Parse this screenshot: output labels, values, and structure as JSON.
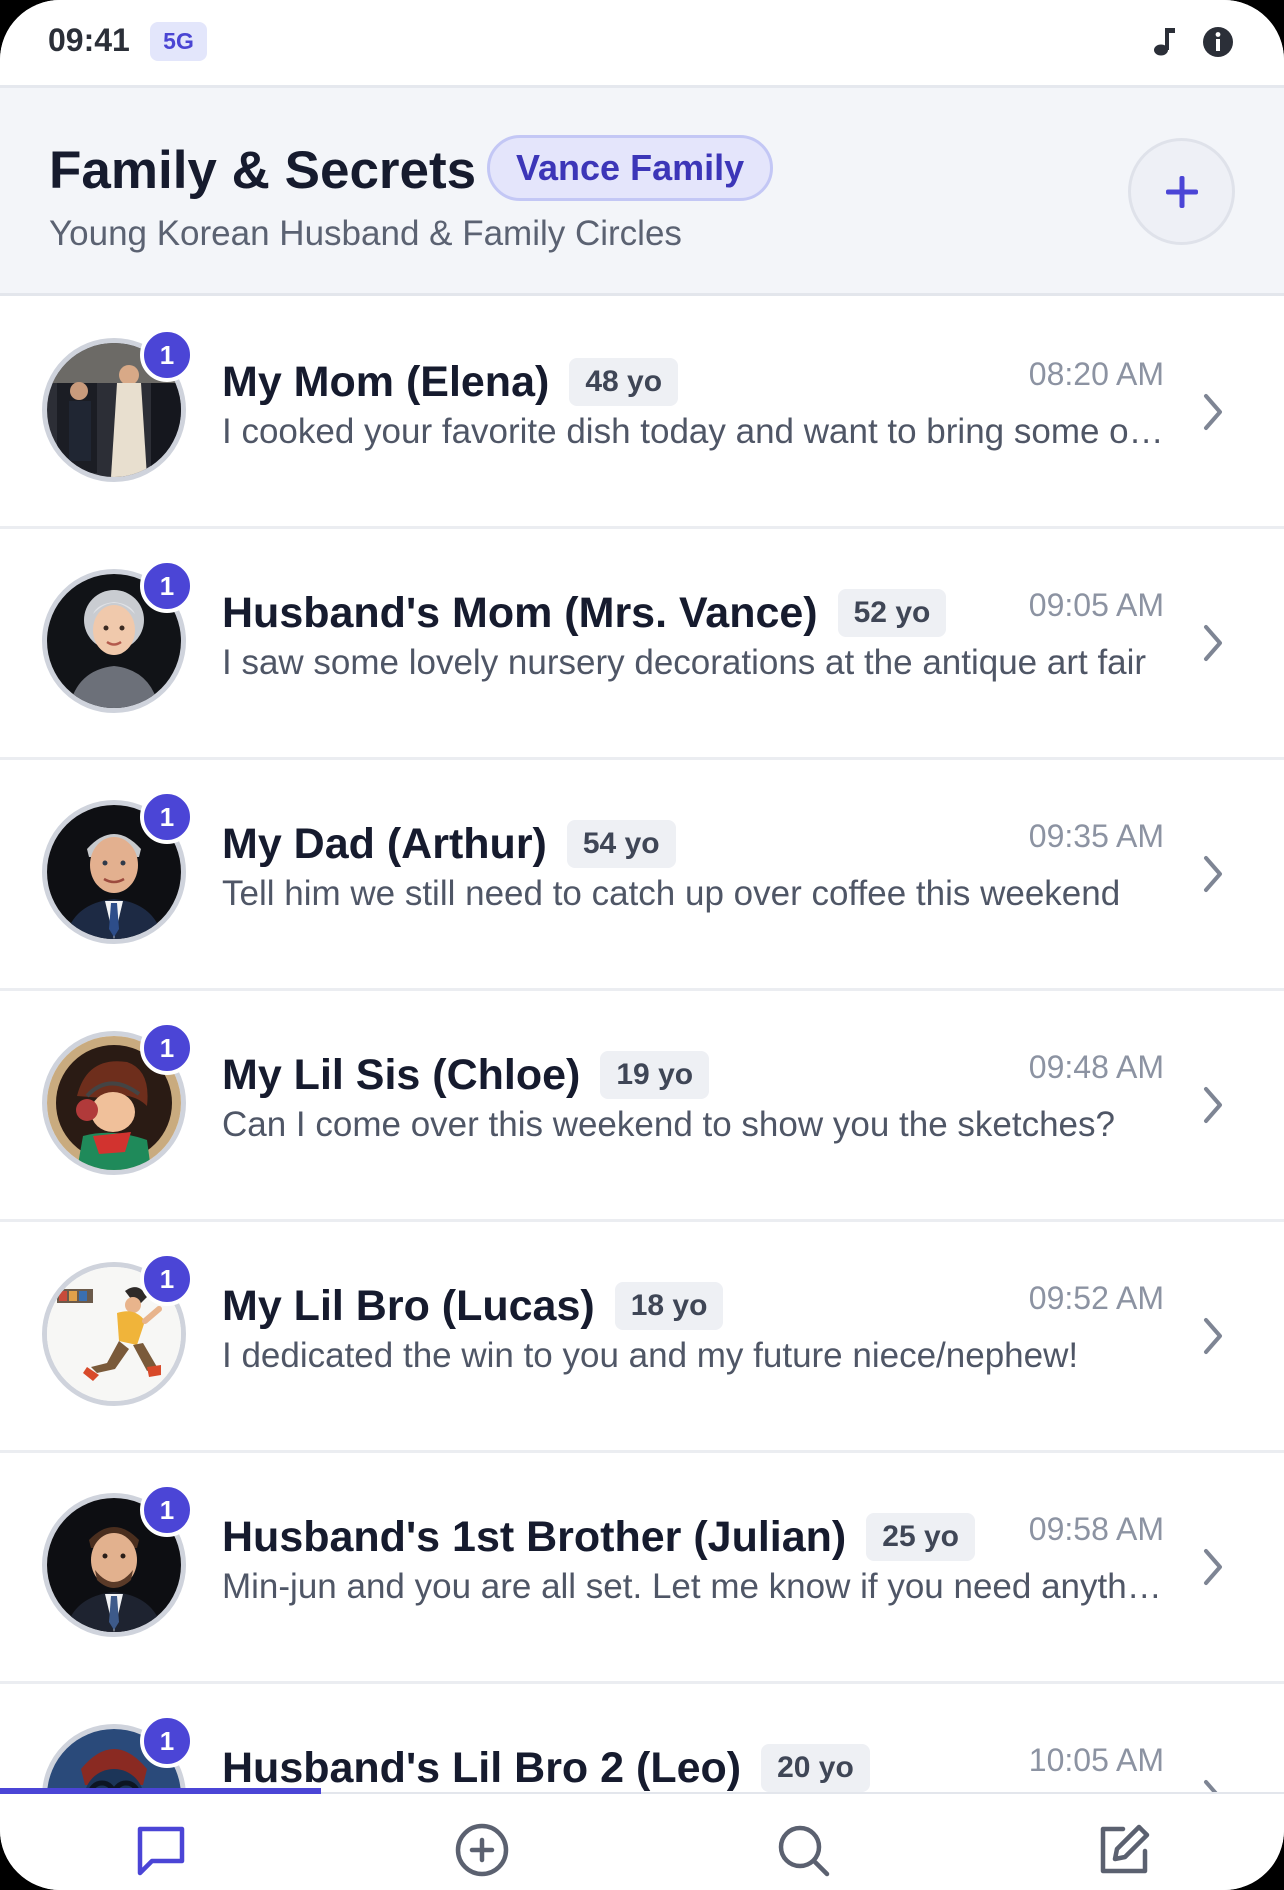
{
  "status": {
    "time": "09:41",
    "network": "5G",
    "icons": [
      "music-note-icon",
      "info-icon"
    ]
  },
  "header": {
    "title": "Family & Secrets",
    "badge": "Vance Family",
    "subtitle": "Young Korean Husband & Family Circles",
    "add_icon": "plus-icon"
  },
  "conversations": [
    {
      "name": "My Mom (Elena)",
      "age": "48 yo",
      "time": "08:20 AM",
      "preview": "I cooked your favorite dish today and want to bring some over",
      "unread": "1"
    },
    {
      "name": "Husband's Mom (Mrs. Vance)",
      "age": "52 yo",
      "time": "09:05 AM",
      "preview": "I saw some lovely nursery decorations at the antique art fair",
      "unread": "1"
    },
    {
      "name": "My Dad (Arthur)",
      "age": "54 yo",
      "time": "09:35 AM",
      "preview": "Tell him we still need to catch up over coffee this weekend",
      "unread": "1"
    },
    {
      "name": "My Lil Sis (Chloe)",
      "age": "19 yo",
      "time": "09:48 AM",
      "preview": "Can I come over this weekend to show you the sketches?",
      "unread": "1"
    },
    {
      "name": "My Lil Bro (Lucas)",
      "age": "18 yo",
      "time": "09:52 AM",
      "preview": "I dedicated the win to you and my future niece/nephew!",
      "unread": "1"
    },
    {
      "name": "Husband's 1st Brother (Julian)",
      "age": "25 yo",
      "time": "09:58 AM",
      "preview": "Min-jun and you are all set. Let me know if you need anything",
      "unread": "1"
    },
    {
      "name": "Husband's Lil Bro 2 (Leo)",
      "age": "20 yo",
      "time": "10:05 AM",
      "preview": "",
      "unread": "1"
    }
  ],
  "tabs": [
    {
      "icon": "chat-bubble-icon",
      "active": true
    },
    {
      "icon": "plus-circle-icon",
      "active": false
    },
    {
      "icon": "search-icon",
      "active": false
    },
    {
      "icon": "compose-icon",
      "active": false
    }
  ],
  "colors": {
    "accent": "#4b45d6",
    "header_bg": "#f3f5f9",
    "badge_bg": "#e4e5fb"
  }
}
